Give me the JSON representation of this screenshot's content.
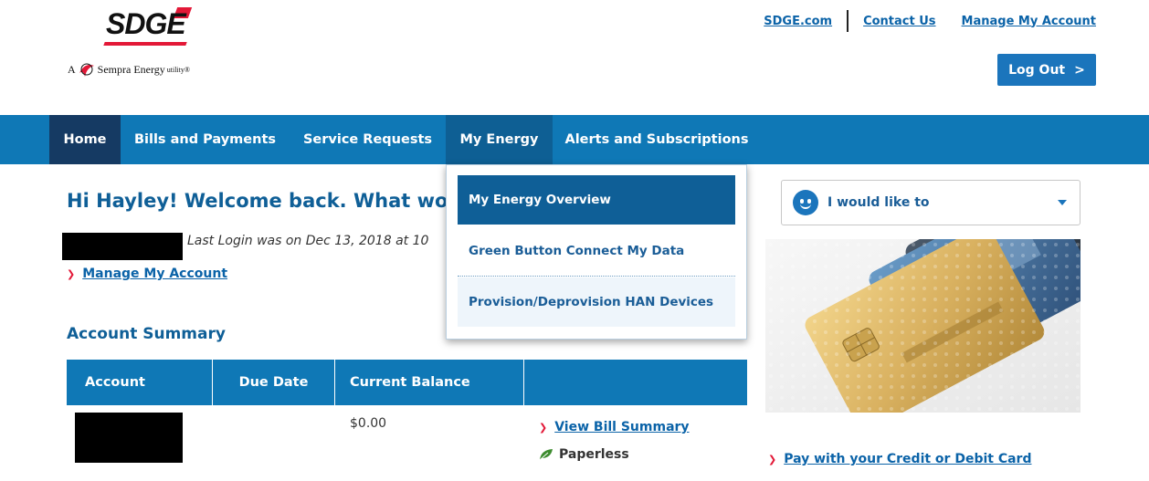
{
  "header": {
    "logo_text": "SDGE",
    "tagline_prefix": "A",
    "tagline": "Sempra Energy",
    "tagline_suffix": "utility®",
    "links": [
      "SDGE.com",
      "Contact Us",
      "Manage My Account"
    ],
    "logout_label": "Log Out",
    "logout_chevron": ">"
  },
  "nav": {
    "items": [
      {
        "label": "Home"
      },
      {
        "label": "Bills and Payments"
      },
      {
        "label": "Service Requests"
      },
      {
        "label": "My Energy"
      },
      {
        "label": "Alerts and Subscriptions"
      }
    ]
  },
  "dropdown": {
    "items": [
      {
        "label": "My Energy Overview"
      },
      {
        "label": "Green Button Connect My Data"
      },
      {
        "label": "Provision/Deprovision HAN Devices"
      }
    ]
  },
  "main": {
    "welcome": "Hi Hayley! Welcome back. What wou",
    "last_login": "Last Login was on Dec 13, 2018 at 10",
    "manage_link": "Manage My Account",
    "account_summary_heading": "Account Summary",
    "table": {
      "headers": [
        "Account",
        "Due Date",
        "Current Balance",
        ""
      ],
      "row": {
        "current_balance": "$0.00",
        "view_bill_link": "View Bill Summary",
        "paperless": "Paperless"
      }
    }
  },
  "sidebar": {
    "i_would_like_to": "I would like to",
    "pay_link": "Pay with your Credit or Debit Card"
  },
  "colors": {
    "primary_blue": "#0f78b6",
    "nav_active": "#153a63",
    "brand_red": "#e31837",
    "link_blue": "#0b63a8"
  }
}
